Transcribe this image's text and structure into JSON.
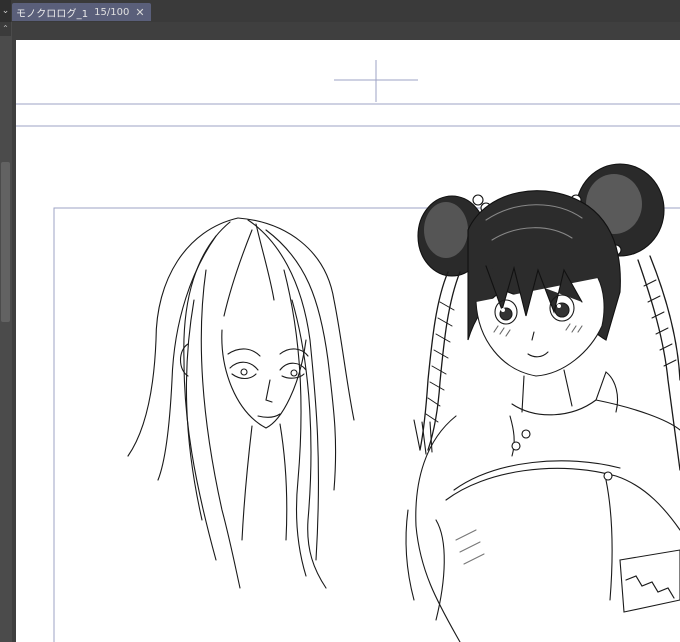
{
  "tabbar": {
    "scroll_glyph": "⌄",
    "document_tab": {
      "title": "モノクロログ_1",
      "zoom": "15/100",
      "close_glyph": "✕"
    }
  },
  "left_gutter": {
    "scroll_glyph": "⌃"
  },
  "canvas": {
    "guide_color": "#9ea3c4",
    "ink_color": "#1a1a1a",
    "icons": [
      "center-crosshair-icon"
    ]
  }
}
